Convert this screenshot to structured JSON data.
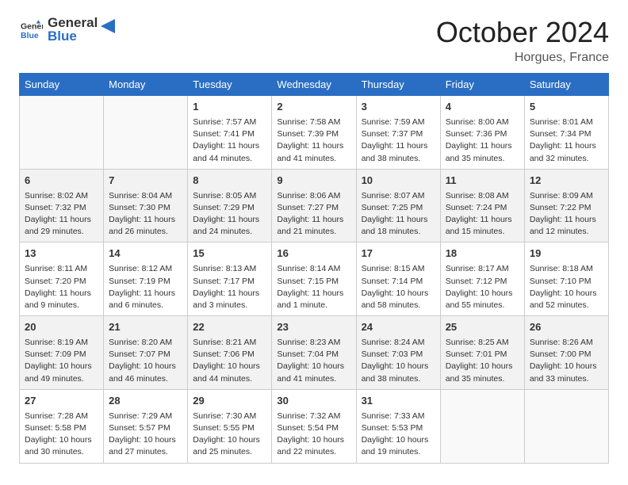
{
  "logo": {
    "line1": "General",
    "line2": "Blue"
  },
  "header": {
    "month": "October 2024",
    "location": "Horgues, France"
  },
  "weekdays": [
    "Sunday",
    "Monday",
    "Tuesday",
    "Wednesday",
    "Thursday",
    "Friday",
    "Saturday"
  ],
  "weeks": [
    [
      {
        "day": "",
        "info": ""
      },
      {
        "day": "",
        "info": ""
      },
      {
        "day": "1",
        "info": "Sunrise: 7:57 AM\nSunset: 7:41 PM\nDaylight: 11 hours and 44 minutes."
      },
      {
        "day": "2",
        "info": "Sunrise: 7:58 AM\nSunset: 7:39 PM\nDaylight: 11 hours and 41 minutes."
      },
      {
        "day": "3",
        "info": "Sunrise: 7:59 AM\nSunset: 7:37 PM\nDaylight: 11 hours and 38 minutes."
      },
      {
        "day": "4",
        "info": "Sunrise: 8:00 AM\nSunset: 7:36 PM\nDaylight: 11 hours and 35 minutes."
      },
      {
        "day": "5",
        "info": "Sunrise: 8:01 AM\nSunset: 7:34 PM\nDaylight: 11 hours and 32 minutes."
      }
    ],
    [
      {
        "day": "6",
        "info": "Sunrise: 8:02 AM\nSunset: 7:32 PM\nDaylight: 11 hours and 29 minutes."
      },
      {
        "day": "7",
        "info": "Sunrise: 8:04 AM\nSunset: 7:30 PM\nDaylight: 11 hours and 26 minutes."
      },
      {
        "day": "8",
        "info": "Sunrise: 8:05 AM\nSunset: 7:29 PM\nDaylight: 11 hours and 24 minutes."
      },
      {
        "day": "9",
        "info": "Sunrise: 8:06 AM\nSunset: 7:27 PM\nDaylight: 11 hours and 21 minutes."
      },
      {
        "day": "10",
        "info": "Sunrise: 8:07 AM\nSunset: 7:25 PM\nDaylight: 11 hours and 18 minutes."
      },
      {
        "day": "11",
        "info": "Sunrise: 8:08 AM\nSunset: 7:24 PM\nDaylight: 11 hours and 15 minutes."
      },
      {
        "day": "12",
        "info": "Sunrise: 8:09 AM\nSunset: 7:22 PM\nDaylight: 11 hours and 12 minutes."
      }
    ],
    [
      {
        "day": "13",
        "info": "Sunrise: 8:11 AM\nSunset: 7:20 PM\nDaylight: 11 hours and 9 minutes."
      },
      {
        "day": "14",
        "info": "Sunrise: 8:12 AM\nSunset: 7:19 PM\nDaylight: 11 hours and 6 minutes."
      },
      {
        "day": "15",
        "info": "Sunrise: 8:13 AM\nSunset: 7:17 PM\nDaylight: 11 hours and 3 minutes."
      },
      {
        "day": "16",
        "info": "Sunrise: 8:14 AM\nSunset: 7:15 PM\nDaylight: 11 hours and 1 minute."
      },
      {
        "day": "17",
        "info": "Sunrise: 8:15 AM\nSunset: 7:14 PM\nDaylight: 10 hours and 58 minutes."
      },
      {
        "day": "18",
        "info": "Sunrise: 8:17 AM\nSunset: 7:12 PM\nDaylight: 10 hours and 55 minutes."
      },
      {
        "day": "19",
        "info": "Sunrise: 8:18 AM\nSunset: 7:10 PM\nDaylight: 10 hours and 52 minutes."
      }
    ],
    [
      {
        "day": "20",
        "info": "Sunrise: 8:19 AM\nSunset: 7:09 PM\nDaylight: 10 hours and 49 minutes."
      },
      {
        "day": "21",
        "info": "Sunrise: 8:20 AM\nSunset: 7:07 PM\nDaylight: 10 hours and 46 minutes."
      },
      {
        "day": "22",
        "info": "Sunrise: 8:21 AM\nSunset: 7:06 PM\nDaylight: 10 hours and 44 minutes."
      },
      {
        "day": "23",
        "info": "Sunrise: 8:23 AM\nSunset: 7:04 PM\nDaylight: 10 hours and 41 minutes."
      },
      {
        "day": "24",
        "info": "Sunrise: 8:24 AM\nSunset: 7:03 PM\nDaylight: 10 hours and 38 minutes."
      },
      {
        "day": "25",
        "info": "Sunrise: 8:25 AM\nSunset: 7:01 PM\nDaylight: 10 hours and 35 minutes."
      },
      {
        "day": "26",
        "info": "Sunrise: 8:26 AM\nSunset: 7:00 PM\nDaylight: 10 hours and 33 minutes."
      }
    ],
    [
      {
        "day": "27",
        "info": "Sunrise: 7:28 AM\nSunset: 5:58 PM\nDaylight: 10 hours and 30 minutes."
      },
      {
        "day": "28",
        "info": "Sunrise: 7:29 AM\nSunset: 5:57 PM\nDaylight: 10 hours and 27 minutes."
      },
      {
        "day": "29",
        "info": "Sunrise: 7:30 AM\nSunset: 5:55 PM\nDaylight: 10 hours and 25 minutes."
      },
      {
        "day": "30",
        "info": "Sunrise: 7:32 AM\nSunset: 5:54 PM\nDaylight: 10 hours and 22 minutes."
      },
      {
        "day": "31",
        "info": "Sunrise: 7:33 AM\nSunset: 5:53 PM\nDaylight: 10 hours and 19 minutes."
      },
      {
        "day": "",
        "info": ""
      },
      {
        "day": "",
        "info": ""
      }
    ]
  ]
}
